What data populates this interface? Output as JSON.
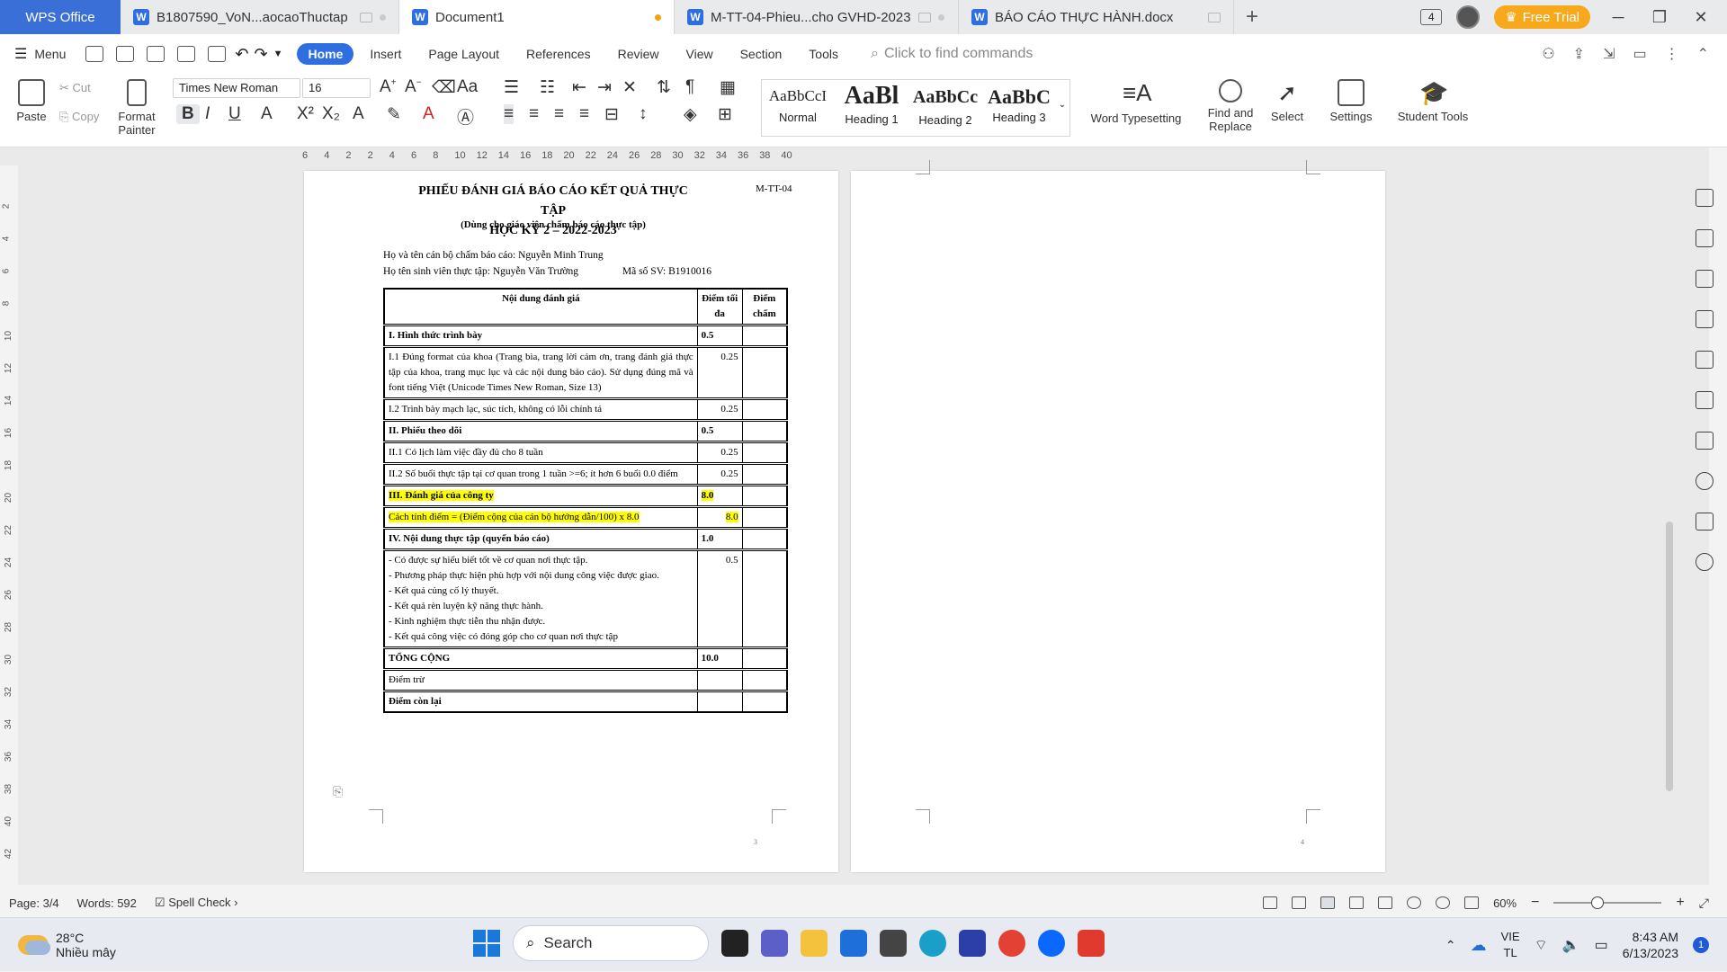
{
  "titlebar": {
    "app": "WPS Office",
    "tabs": [
      {
        "label": "B1807590_VoN...aocaoThuctap",
        "active": false
      },
      {
        "label": "Document1",
        "active": true
      },
      {
        "label": "M-TT-04-Phieu...cho GVHD-2023",
        "active": false
      },
      {
        "label": "BÁO CÁO THỰC HÀNH.docx",
        "active": false
      }
    ],
    "window_count": "4",
    "free_trial": "Free Trial"
  },
  "menu": {
    "menu_label": "Menu",
    "items": [
      "Home",
      "Insert",
      "Page Layout",
      "References",
      "Review",
      "View",
      "Section",
      "Tools"
    ],
    "find_commands": "Click to find commands"
  },
  "ribbon": {
    "paste": "Paste",
    "cut": "Cut",
    "copy": "Copy",
    "format_painter": "Format Painter",
    "font_name": "Times New Roman",
    "font_size": "16",
    "styles": [
      {
        "sample": "AaBbCcI",
        "name": "Normal"
      },
      {
        "sample": "AaBl",
        "name": "Heading 1"
      },
      {
        "sample": "AaBbCc",
        "name": "Heading 2"
      },
      {
        "sample": "AaBbC",
        "name": "Heading 3"
      }
    ],
    "word_typesetting": "Word Typesetting",
    "find_replace": "Find and Replace",
    "select": "Select",
    "settings": "Settings",
    "student_tools": "Student Tools"
  },
  "ruler": [
    "6",
    "4",
    "2",
    "2",
    "4",
    "6",
    "8",
    "10",
    "12",
    "14",
    "16",
    "18",
    "20",
    "22",
    "24",
    "26",
    "28",
    "30",
    "32",
    "34",
    "36",
    "38",
    "40"
  ],
  "vruler": [
    "2",
    "4",
    "6",
    "8",
    "10",
    "12",
    "14",
    "16",
    "18",
    "20",
    "22",
    "24",
    "26",
    "28",
    "30",
    "32",
    "34",
    "36",
    "38",
    "40",
    "42"
  ],
  "document": {
    "title1": "PHIẾU ĐÁNH GIÁ BÁO CÁO KẾT QUẢ THỰC TẬP",
    "title2": "HỌC KỲ 2 – 2022-2023",
    "subtitle": "(Dùng cho giáo viên chấm báo cáo thực tập)",
    "code": "M-TT-04",
    "reviewer": "Họ và tên cán bộ chấm báo cáo: Nguyễn Minh Trung",
    "student": "Họ tên sinh viên thực tập: Nguyễn Văn Trường",
    "student_id": "Mã số SV:  B1910016",
    "table_header": {
      "content": "Nội dung  đánh giá",
      "max": "Điểm tối đa",
      "score": "Điểm chấm"
    },
    "rows": [
      {
        "content": "I. Hình thức trình bày",
        "max": "0.5",
        "bold": true
      },
      {
        "content": "I.1 Đúng format của khoa (Trang bìa, trang lời cảm ơn, trang đánh giá thực tập của khoa,  trang mục lục và các nội dung báo cáo). Sử dụng đúng mã và font tiếng Việt (Unicode Times New Roman, Size 13)",
        "max": "0.25",
        "bold": false
      },
      {
        "content": "I.2 Trình bày mạch lạc, súc tích, không có lỗi chính tả",
        "max": "0.25",
        "bold": false
      },
      {
        "content": "II.  Phiếu theo dõi",
        "max": "0.5",
        "bold": true
      },
      {
        "content": "II.1 Có lịch làm việc đầy đủ cho 8 tuần",
        "max": "0.25",
        "bold": false
      },
      {
        "content": "II.2 Số buổi thực tập tại cơ quan trong 1 tuần >=6; ít hơn 6 buổi 0.0 điểm",
        "max": "0.25",
        "bold": false
      },
      {
        "content": "III. Đánh giá của công ty",
        "max": "8.0",
        "bold": true,
        "highlight": true
      },
      {
        "content": "Cách tính điểm = (Điểm cộng của cán bộ hướng dẫn/100) x 8.0",
        "max": "8.0",
        "bold": false,
        "highlight": true
      },
      {
        "content": "IV. Nội dung thực tập (quyển báo cáo)",
        "max": "1.0",
        "bold": true
      }
    ],
    "iv_items": [
      "- Có được sự hiểu biết tốt về cơ quan nơi thực tập.",
      "- Phương pháp thực hiện phù hợp với nội dung công việc được giao.",
      "- Kết quả củng cố lý thuyết.",
      "- Kết quả rèn luyện kỹ năng thực hành.",
      "- Kinh nghiệm thực tiễn thu nhận được.",
      "- Kết quả công việc có đóng góp cho cơ quan nơi thực tập"
    ],
    "iv_max": "0.5",
    "total_label": "TỔNG CỘNG",
    "total_max": "10.0",
    "deduct_label": "Điểm trừ",
    "remaining_label": "Điểm còn lại",
    "page_num_left": "3",
    "page_num_right": "4"
  },
  "status": {
    "page": "Page: 3/4",
    "words": "Words: 592",
    "spell": "Spell Check",
    "zoom": "60%"
  },
  "taskbar": {
    "temp": "28°C",
    "weather": "Nhiều mây",
    "search": "Search",
    "lang1": "VIE",
    "lang2": "TL",
    "time": "8:43 AM",
    "date": "6/13/2023",
    "notifications": "1"
  }
}
